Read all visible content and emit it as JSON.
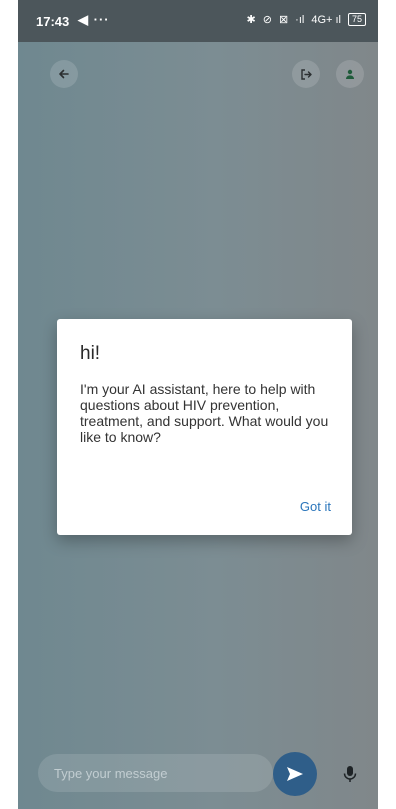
{
  "status_bar": {
    "time": "17:43",
    "extra": "◀ ···",
    "icons": [
      "✱",
      "⊘",
      "⊠",
      "·ıl",
      "4G+ ıl"
    ],
    "battery": "75"
  },
  "app_bar": {
    "back_icon": "arrow-left",
    "logout_icon": "logout-arrow",
    "profile_icon": "person"
  },
  "dialog": {
    "title": "hi!",
    "message": "I'm your AI assistant, here to help with questions about HIV prevention, treatment, and support. What would you like to know?",
    "button_label": "Got it"
  },
  "composer": {
    "placeholder": "Type your message",
    "send_icon": "send",
    "mic_icon": "microphone"
  },
  "colors": {
    "status_bar": "#4c565b",
    "accent": "#2a75bb",
    "send_button": "#2f5e89"
  }
}
